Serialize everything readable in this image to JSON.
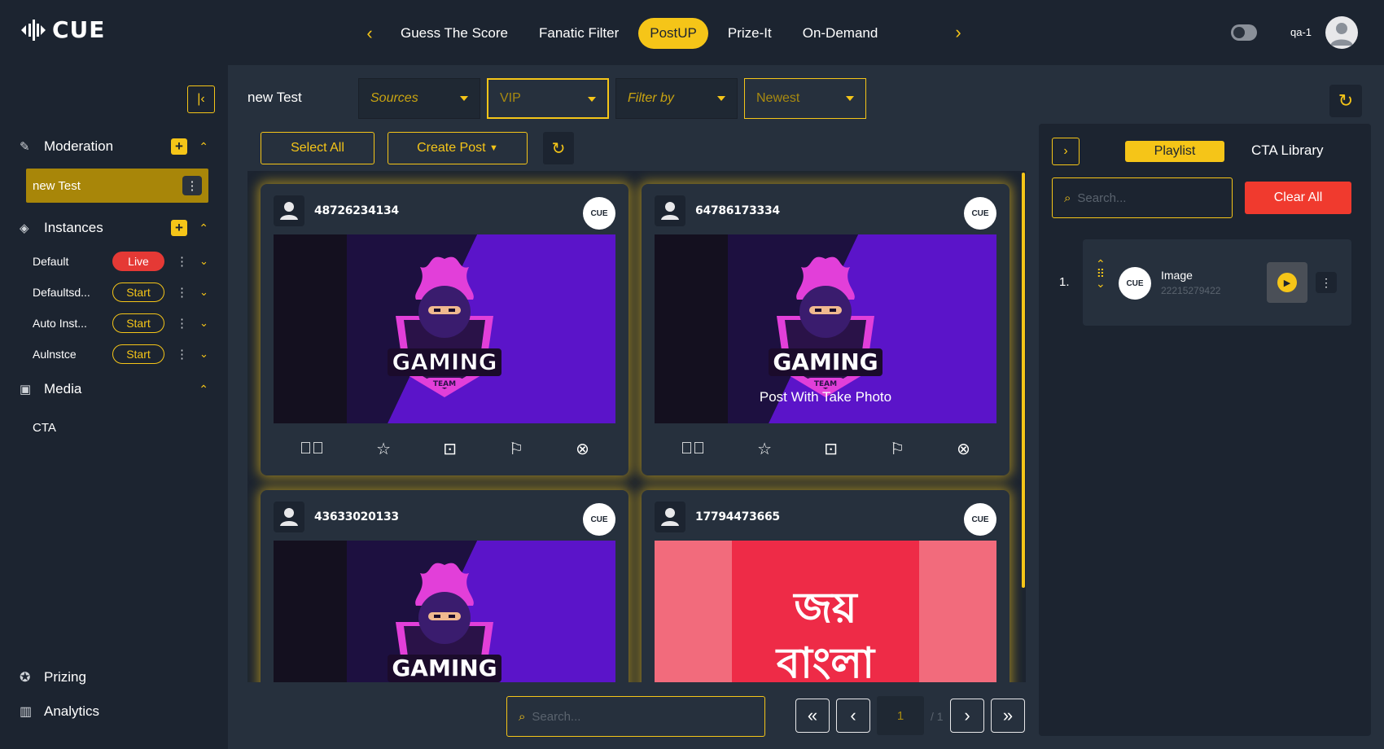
{
  "app": {
    "logo_text": "CUE"
  },
  "nav": {
    "items": [
      "Guess The Score",
      "Fanatic Filter",
      "PostUP",
      "Prize-It",
      "On-Demand"
    ],
    "active": "PostUP"
  },
  "user": {
    "name": "qa-1"
  },
  "sidebar": {
    "moderation_label": "Moderation",
    "moderation_item": "new Test",
    "instances_label": "Instances",
    "instances": [
      {
        "label": "Default",
        "status": "Live"
      },
      {
        "label": "Defaultsd...",
        "status": "Start"
      },
      {
        "label": "Auto Inst...",
        "status": "Start"
      },
      {
        "label": "Aulnstce",
        "status": "Start"
      }
    ],
    "media_label": "Media",
    "media_item": "CTA",
    "prizing_label": "Prizing",
    "analytics_label": "Analytics"
  },
  "main": {
    "title": "new Test",
    "filters": {
      "sources": "Sources",
      "vip": "VIP",
      "filter_by": "Filter by",
      "sort": "Newest"
    },
    "select_all": "Select All",
    "create_post": "Create Post"
  },
  "posts": [
    {
      "user_id": "48726234134",
      "badge": "CUE",
      "image": "gaming",
      "overlay": ""
    },
    {
      "user_id": "64786173334",
      "badge": "CUE",
      "image": "gaming",
      "overlay": "Post With Take Photo"
    },
    {
      "user_id": "43633020133",
      "badge": "CUE",
      "image": "gaming",
      "overlay": ""
    },
    {
      "user_id": "17794473665",
      "badge": "CUE",
      "image": "joy-bangla",
      "overlay": ""
    }
  ],
  "image_text": {
    "gaming": "GAMING",
    "team": "TEAM",
    "joy_bangla_1": "জয়",
    "joy_bangla_2": "বাংলা"
  },
  "pagination": {
    "search_placeholder": "Search...",
    "page": "1",
    "total": "/ 1"
  },
  "right_panel": {
    "tab_playlist": "Playlist",
    "tab_cta": "CTA Library",
    "search_placeholder": "Search...",
    "clear_all": "Clear All",
    "playlist": [
      {
        "num": "1.",
        "title": "Image",
        "id": "22215279422",
        "badge": "CUE"
      }
    ]
  },
  "colors": {
    "accent": "#f5c518",
    "bg": "#1c2430",
    "panel": "#26303d",
    "danger": "#f03a2e"
  }
}
